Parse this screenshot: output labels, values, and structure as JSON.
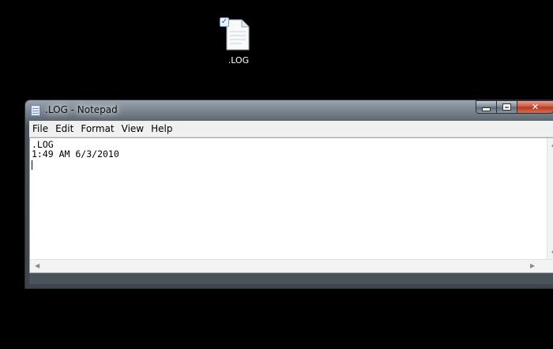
{
  "desktop": {
    "file_icon": {
      "label": ".LOG",
      "icon": "text-document-icon",
      "checked": true
    }
  },
  "window": {
    "title": ".LOG - Notepad",
    "app_icon": "notepad-icon",
    "controls": {
      "minimize": "minimize-icon",
      "maximize": "maximize-icon",
      "close": "close-icon"
    }
  },
  "menu": [
    {
      "label": "File"
    },
    {
      "label": "Edit"
    },
    {
      "label": "Format"
    },
    {
      "label": "View"
    },
    {
      "label": "Help"
    }
  ],
  "editor": {
    "lines": [
      ".LOG",
      "1:49 AM 6/3/2010"
    ]
  },
  "colors": {
    "desktop_bg": "#000000",
    "close_button": "#c7513b",
    "editor_bg": "#ffffff"
  }
}
